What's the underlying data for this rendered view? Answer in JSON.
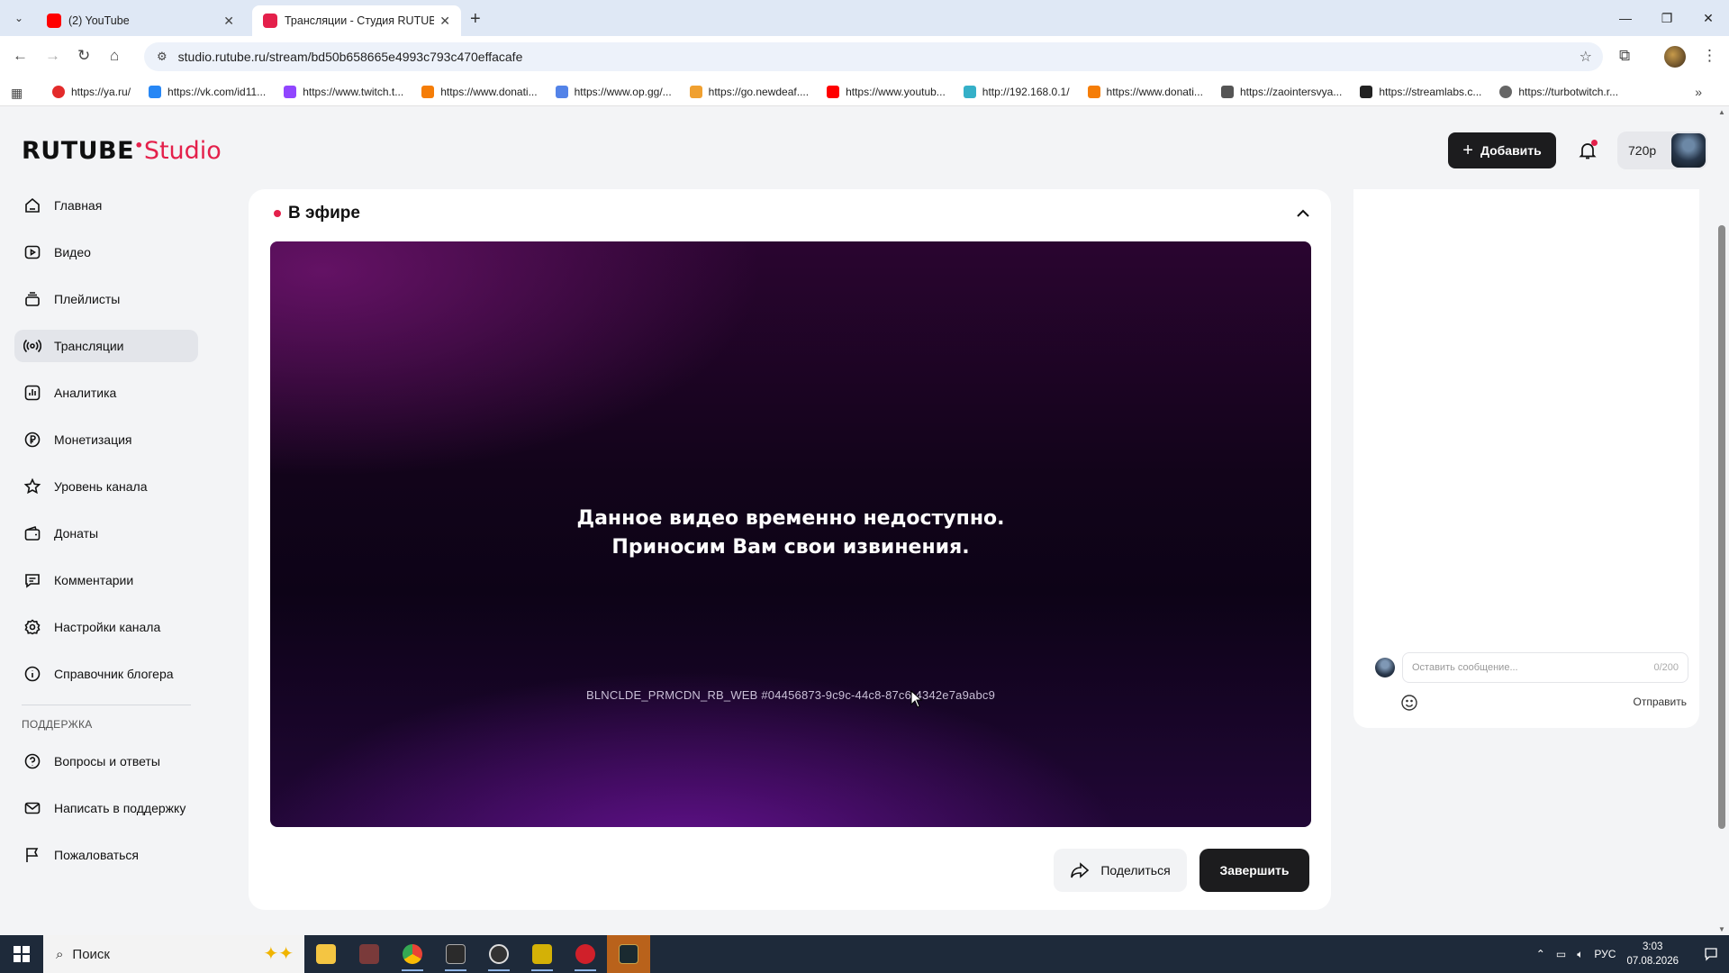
{
  "browser": {
    "tabs": [
      {
        "title": "(2) YouTube",
        "active": false,
        "favicon_color": "#ff0000"
      },
      {
        "title": "Трансляции - Студия RUTUBE",
        "active": true,
        "favicon_color": "#e4204b"
      }
    ],
    "url": "studio.rutube.ru/stream/bd50b658665e4993c793c470effacafe",
    "bookmarks": [
      {
        "label": "https://ya.ru/",
        "color": "#e32b2b"
      },
      {
        "label": "https://vk.com/id11...",
        "color": "#2787f5"
      },
      {
        "label": "https://www.twitch.t...",
        "color": "#9146ff"
      },
      {
        "label": "https://www.donati...",
        "color": "#f57d07"
      },
      {
        "label": "https://www.op.gg/...",
        "color": "#5383e8"
      },
      {
        "label": "https://go.newdeaf....",
        "color": "#f0a030"
      },
      {
        "label": "https://www.youtub...",
        "color": "#ff0000"
      },
      {
        "label": "http://192.168.0.1/",
        "color": "#35b0c8"
      },
      {
        "label": "https://www.donati...",
        "color": "#f57d07"
      },
      {
        "label": "https://zaointersvya...",
        "color": "#555555"
      },
      {
        "label": "https://streamlabs.c...",
        "color": "#222222"
      },
      {
        "label": "https://turbotwitch.r...",
        "color": "#666666"
      }
    ]
  },
  "app": {
    "logo_main": "RUTUBE",
    "logo_studio": "Studio",
    "add_button": "Добавить",
    "quality": "720p",
    "accent": "#e4204b"
  },
  "sidebar": {
    "items": [
      {
        "label": "Главная",
        "icon": "home-icon"
      },
      {
        "label": "Видео",
        "icon": "video-icon"
      },
      {
        "label": "Плейлисты",
        "icon": "playlist-icon"
      },
      {
        "label": "Трансляции",
        "icon": "broadcast-icon",
        "active": true
      },
      {
        "label": "Аналитика",
        "icon": "analytics-icon"
      },
      {
        "label": "Монетизация",
        "icon": "ruble-icon"
      },
      {
        "label": "Уровень канала",
        "icon": "star-icon"
      },
      {
        "label": "Донаты",
        "icon": "wallet-icon"
      },
      {
        "label": "Комментарии",
        "icon": "comment-icon"
      },
      {
        "label": "Настройки канала",
        "icon": "gear-icon"
      },
      {
        "label": "Справочник блогера",
        "icon": "info-icon"
      }
    ],
    "support_title": "ПОДДЕРЖКА",
    "support_items": [
      {
        "label": "Вопросы и ответы",
        "icon": "question-icon"
      },
      {
        "label": "Написать в поддержку",
        "icon": "mail-icon"
      },
      {
        "label": "Пожаловаться",
        "icon": "flag-icon"
      }
    ]
  },
  "stream": {
    "status": "В эфире",
    "message_line1": "Данное видео временно недоступно.",
    "message_line2": "Приносим Вам свои извинения.",
    "error_code": "BLNCLDE_PRMCDN_RB_WEB #04456873-9c9c-44c8-87c6-4342e7a9abc9",
    "share_button": "Поделиться",
    "finish_button": "Завершить"
  },
  "chat": {
    "placeholder": "Оставить сообщение...",
    "counter": "0/200",
    "send": "Отправить"
  },
  "taskbar": {
    "search": "Поиск",
    "language": "РУС",
    "time": "3:03",
    "date": "07.08.2026"
  }
}
